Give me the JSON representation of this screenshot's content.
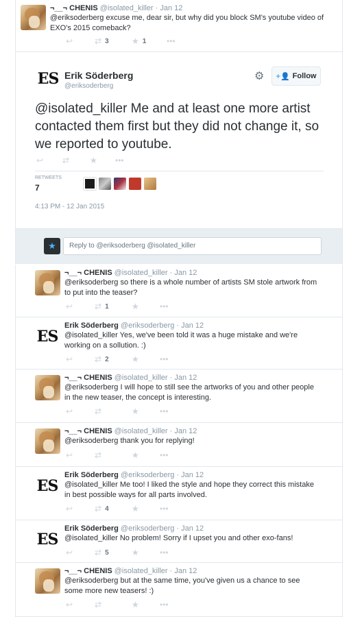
{
  "top_tweet": {
    "name": "¬__¬ CHENIS",
    "handle": "@isolated_killer",
    "time": "· Jan 12",
    "text": "@eriksoderberg excuse me, dear sir, but why did you block SM's youtube video of EXO's 2015 comeback?",
    "retweets": "3",
    "favorites": "1"
  },
  "main_tweet": {
    "avatar_text": "ES",
    "name": "Erik Söderberg",
    "handle": "@eriksoderberg",
    "follow_label": "Follow",
    "text": "@isolated_killer Me and at least one more artist contacted them first but they did not change it, so we reported to youtube.",
    "retweets_label": "RETWEETS",
    "retweets_count": "7",
    "timestamp": "4:13 PM - 12 Jan 2015"
  },
  "reply_box": {
    "placeholder": "Reply to @eriksoderberg @isolated_killer"
  },
  "replies": [
    {
      "name": "¬__¬ CHENIS",
      "handle": "@isolated_killer",
      "time": "· Jan 12",
      "text": "@eriksoderberg so there is a whole number of artists SM stole artwork from to put into the teaser?",
      "retweets": "1"
    },
    {
      "name": "Erik Söderberg",
      "handle": "@eriksoderberg",
      "time": "· Jan 12",
      "text": "@isolated_killer Yes, we've been told it was a huge mistake and we're working on a sollution. :)",
      "retweets": "2"
    },
    {
      "name": "¬__¬ CHENIS",
      "handle": "@isolated_killer",
      "time": "· Jan 12",
      "text": "@eriksoderberg I will hope to still see the artworks of you and other people in the new teaser, the concept is interesting.",
      "retweets": ""
    },
    {
      "name": "¬__¬ CHENIS",
      "handle": "@isolated_killer",
      "time": "· Jan 12",
      "text": "@eriksoderberg thank you for replying!",
      "retweets": ""
    },
    {
      "name": "Erik Söderberg",
      "handle": "@eriksoderberg",
      "time": "· Jan 12",
      "text": "@isolated_killer Me too! I liked the style and hope they correct this mistake in best possible ways for all parts involved.",
      "retweets": "4"
    },
    {
      "name": "Erik Söderberg",
      "handle": "@eriksoderberg",
      "time": "· Jan 12",
      "text": "@isolated_killer No problem! Sorry if I upset you and other exo-fans!",
      "retweets": "5"
    },
    {
      "name": "¬__¬ CHENIS",
      "handle": "@isolated_killer",
      "time": "· Jan 12",
      "text": "@eriksoderberg but at the same time, you've given us a chance to see some more new teasers! :)",
      "retweets": ""
    }
  ],
  "icons": {
    "reply": "reply-icon",
    "retweet": "retweet-icon",
    "favorite": "star-icon",
    "more": "more-icon",
    "settings": "gear-icon",
    "follow": "add-person-icon"
  },
  "colors": {
    "accent": "#55acee",
    "border": "#e1e8ed",
    "muted": "#8899a6",
    "text": "#292f33"
  }
}
